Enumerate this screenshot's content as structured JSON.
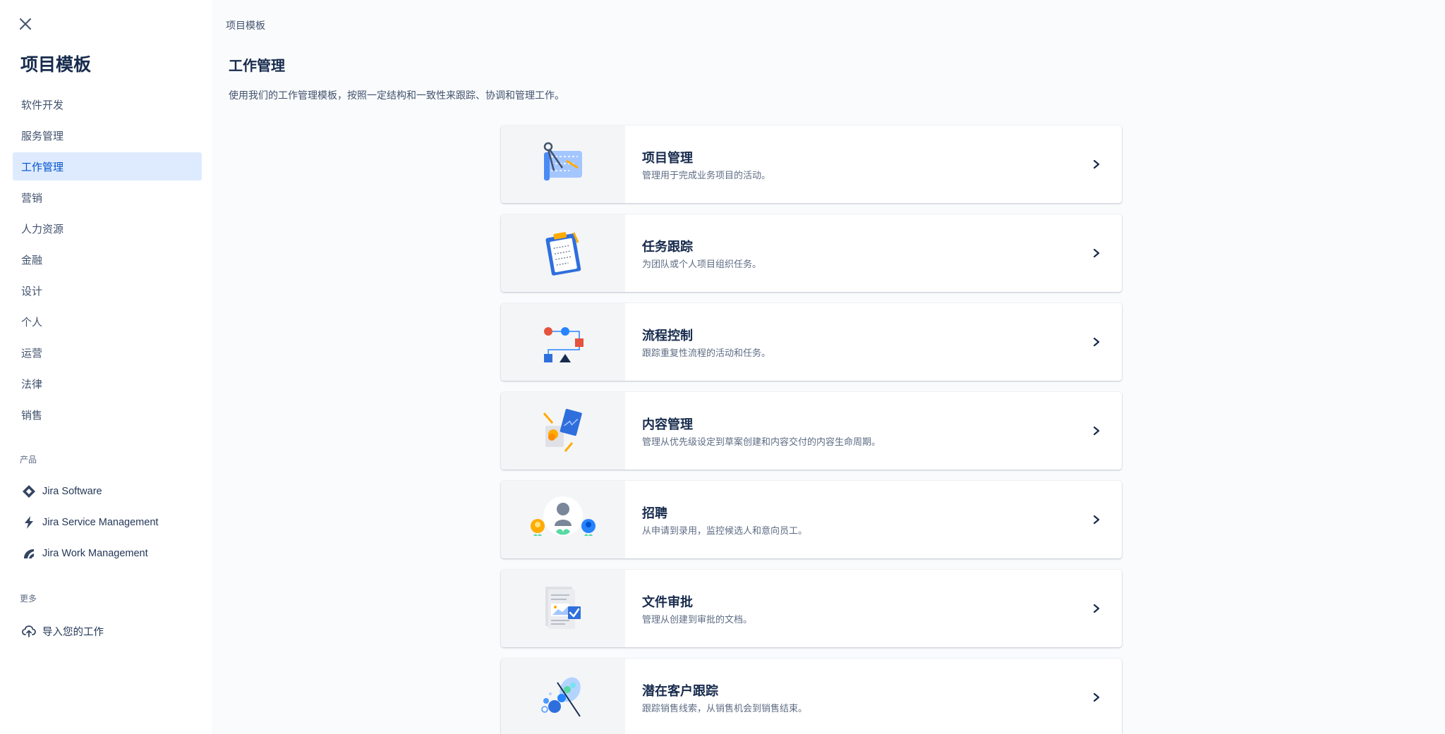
{
  "sidebar": {
    "title": "项目模板",
    "nav": [
      {
        "label": "软件开发"
      },
      {
        "label": "服务管理"
      },
      {
        "label": "工作管理"
      },
      {
        "label": "营销"
      },
      {
        "label": "人力资源"
      },
      {
        "label": "金融"
      },
      {
        "label": "设计"
      },
      {
        "label": "个人"
      },
      {
        "label": "运营"
      },
      {
        "label": "法律"
      },
      {
        "label": "销售"
      }
    ],
    "active_item": "工作管理",
    "products_label": "产品",
    "products": [
      {
        "label": "Jira Software",
        "icon": "jira-software-icon"
      },
      {
        "label": "Jira Service Management",
        "icon": "jira-service-management-icon"
      },
      {
        "label": "Jira Work Management",
        "icon": "jira-work-management-icon"
      }
    ],
    "more_label": "更多",
    "import_label": "导入您的工作"
  },
  "main": {
    "breadcrumb": "项目模板",
    "title": "工作管理",
    "description": "使用我们的工作管理模板，按照一定结构和一致性来跟踪、协调和管理工作。",
    "templates": [
      {
        "title": "项目管理",
        "desc": "管理用于完成业务项目的活动。",
        "icon": "blueprint-icon"
      },
      {
        "title": "任务跟踪",
        "desc": "为团队或个人项目组织任务。",
        "icon": "clipboard-icon"
      },
      {
        "title": "流程控制",
        "desc": "跟踪重复性流程的活动和任务。",
        "icon": "flowchart-icon"
      },
      {
        "title": "内容管理",
        "desc": "管理从优先级设定到草案创建和内容交付的内容生命周期。",
        "icon": "content-icon"
      },
      {
        "title": "招聘",
        "desc": "从申请到录用，监控候选人和意向员工。",
        "icon": "recruiting-icon"
      },
      {
        "title": "文件审批",
        "desc": "管理从创建到审批的文档。",
        "icon": "document-approval-icon"
      },
      {
        "title": "潜在客户跟踪",
        "desc": "跟踪销售线索，从销售机会到销售结束。",
        "icon": "lead-tracking-icon"
      }
    ]
  },
  "colors": {
    "accent": "#0052cc",
    "active_bg": "#deebff",
    "text": "#172b4d"
  }
}
